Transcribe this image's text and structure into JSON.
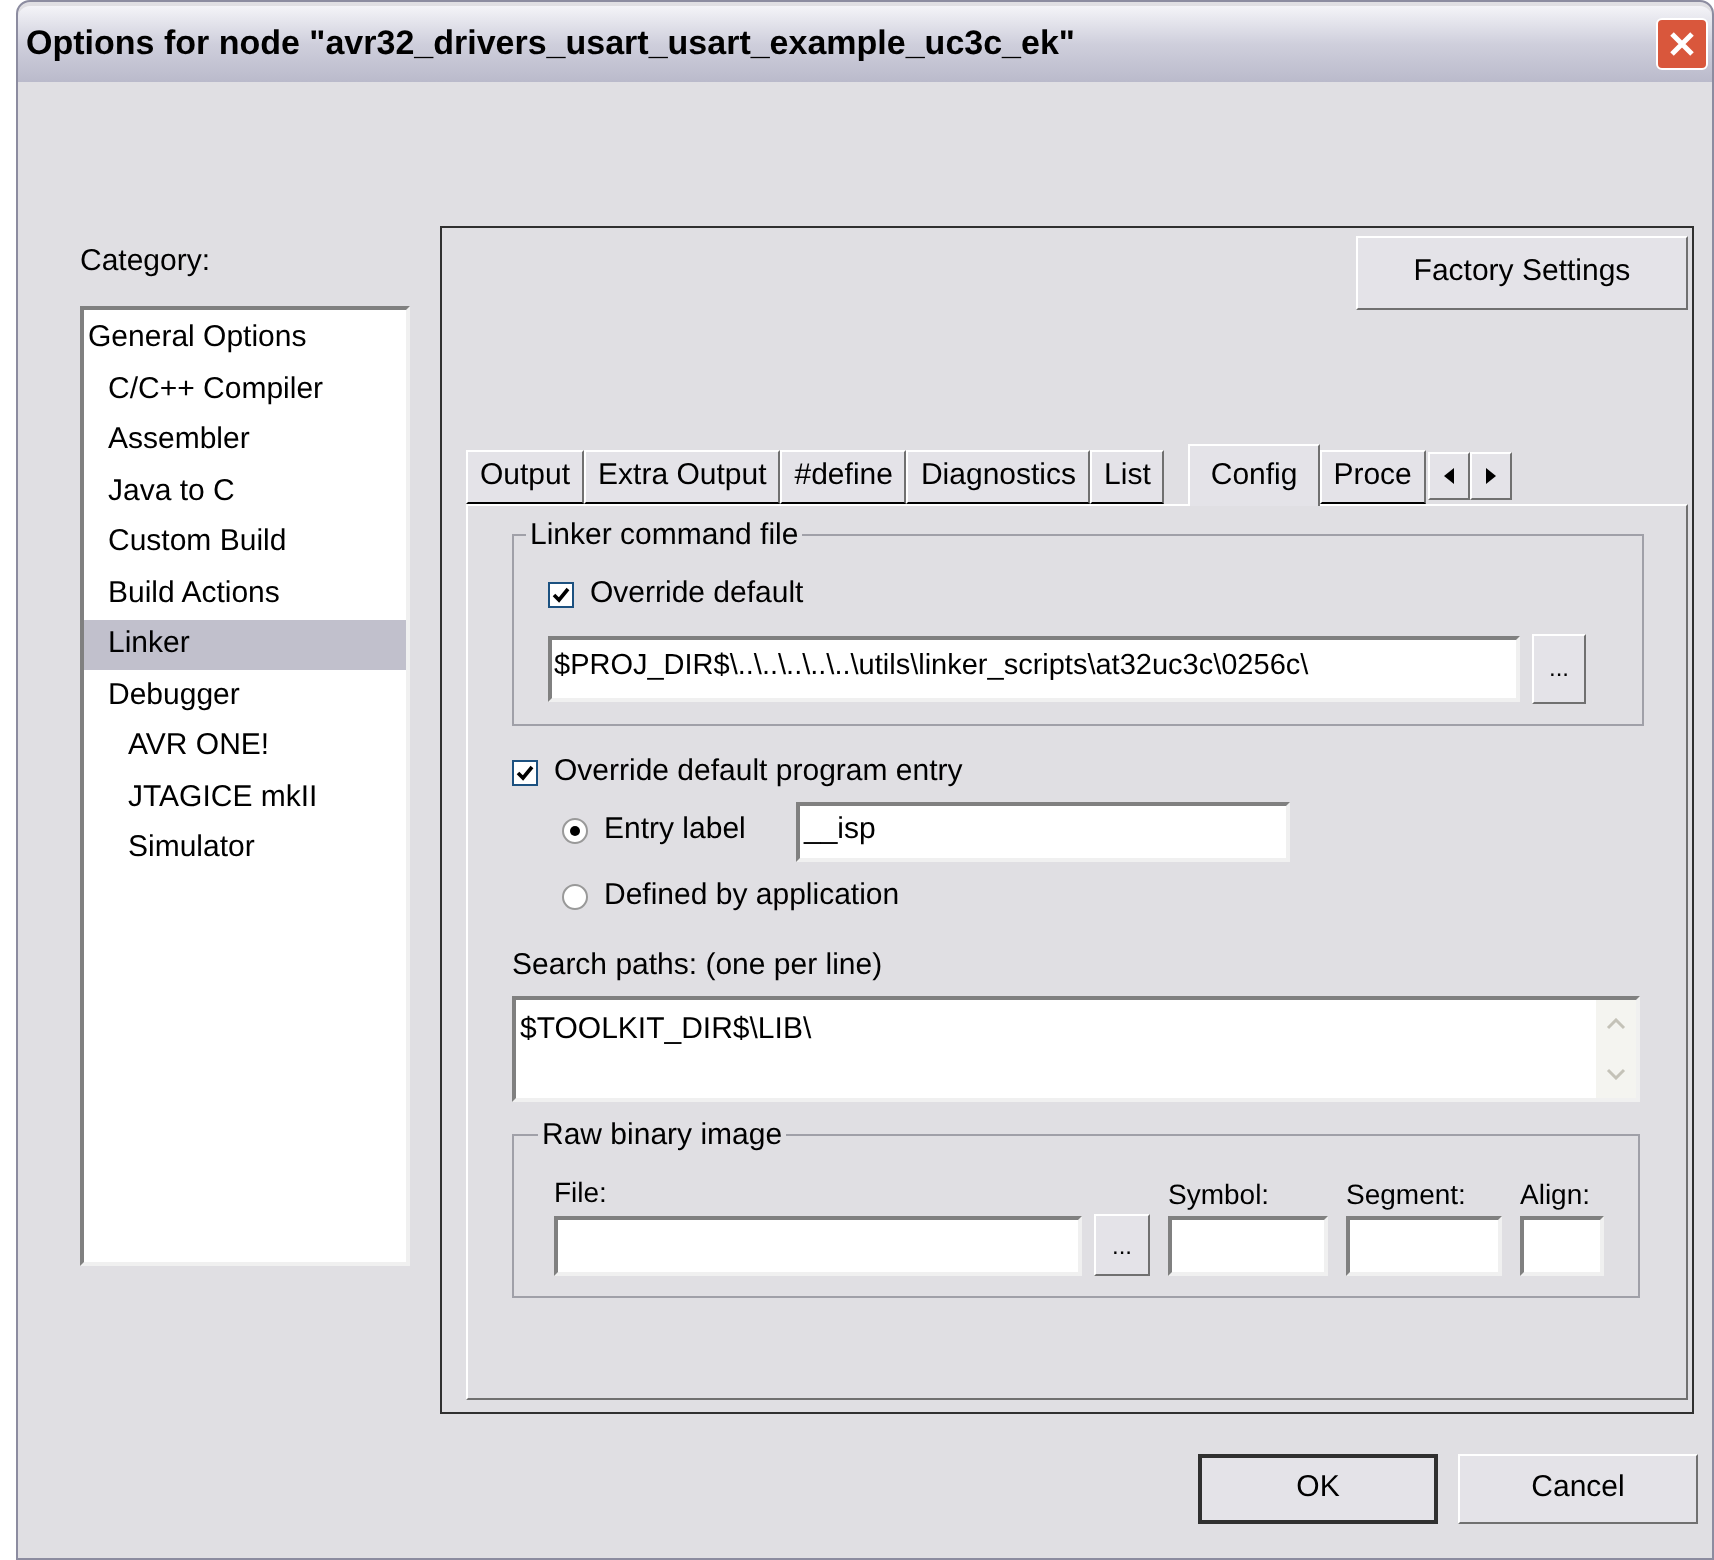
{
  "window": {
    "title": "Options for node \"avr32_drivers_usart_usart_example_uc3c_ek\""
  },
  "category": {
    "label": "Category:",
    "items": [
      {
        "label": "General Options",
        "selected": false,
        "children": [
          {
            "label": "C/C++ Compiler",
            "selected": false
          },
          {
            "label": "Assembler",
            "selected": false
          },
          {
            "label": "Java to C",
            "selected": false
          },
          {
            "label": "Custom Build",
            "selected": false
          },
          {
            "label": "Build Actions",
            "selected": false
          },
          {
            "label": "Linker",
            "selected": true
          },
          {
            "label": "Debugger",
            "selected": false,
            "children": [
              {
                "label": "AVR ONE!",
                "selected": false
              },
              {
                "label": "JTAGICE mkII",
                "selected": false
              },
              {
                "label": "Simulator",
                "selected": false
              }
            ]
          }
        ]
      }
    ]
  },
  "factory_button": "Factory Settings",
  "tabs": [
    {
      "label": "Output",
      "selected": false
    },
    {
      "label": "Extra Output",
      "selected": false
    },
    {
      "label": "#define",
      "selected": false
    },
    {
      "label": "Diagnostics",
      "selected": false
    },
    {
      "label": "List",
      "selected": false
    },
    {
      "label": "Config",
      "selected": true
    },
    {
      "label": "Proce",
      "selected": false
    }
  ],
  "linker_file": {
    "title": "Linker command file",
    "override": {
      "label": "Override default",
      "checked": true
    },
    "path": "$PROJ_DIR$\\..\\..\\..\\..\\..\\utils\\linker_scripts\\at32uc3c\\0256c\\",
    "browse": "..."
  },
  "program_entry": {
    "label": "Override default program entry",
    "checked": true,
    "options": [
      {
        "label": "Entry label",
        "selected": true,
        "value": "__isp"
      },
      {
        "label": "Defined by application",
        "selected": false
      }
    ]
  },
  "search_paths": {
    "label": "Search paths:  (one per line)",
    "value": "$TOOLKIT_DIR$\\LIB\\"
  },
  "raw_binary": {
    "title": "Raw binary image",
    "file_label": "File:",
    "browse": "...",
    "symbol_label": "Symbol:",
    "segment_label": "Segment:",
    "align_label": "Align:"
  },
  "buttons": [
    "OK",
    "Cancel"
  ]
}
